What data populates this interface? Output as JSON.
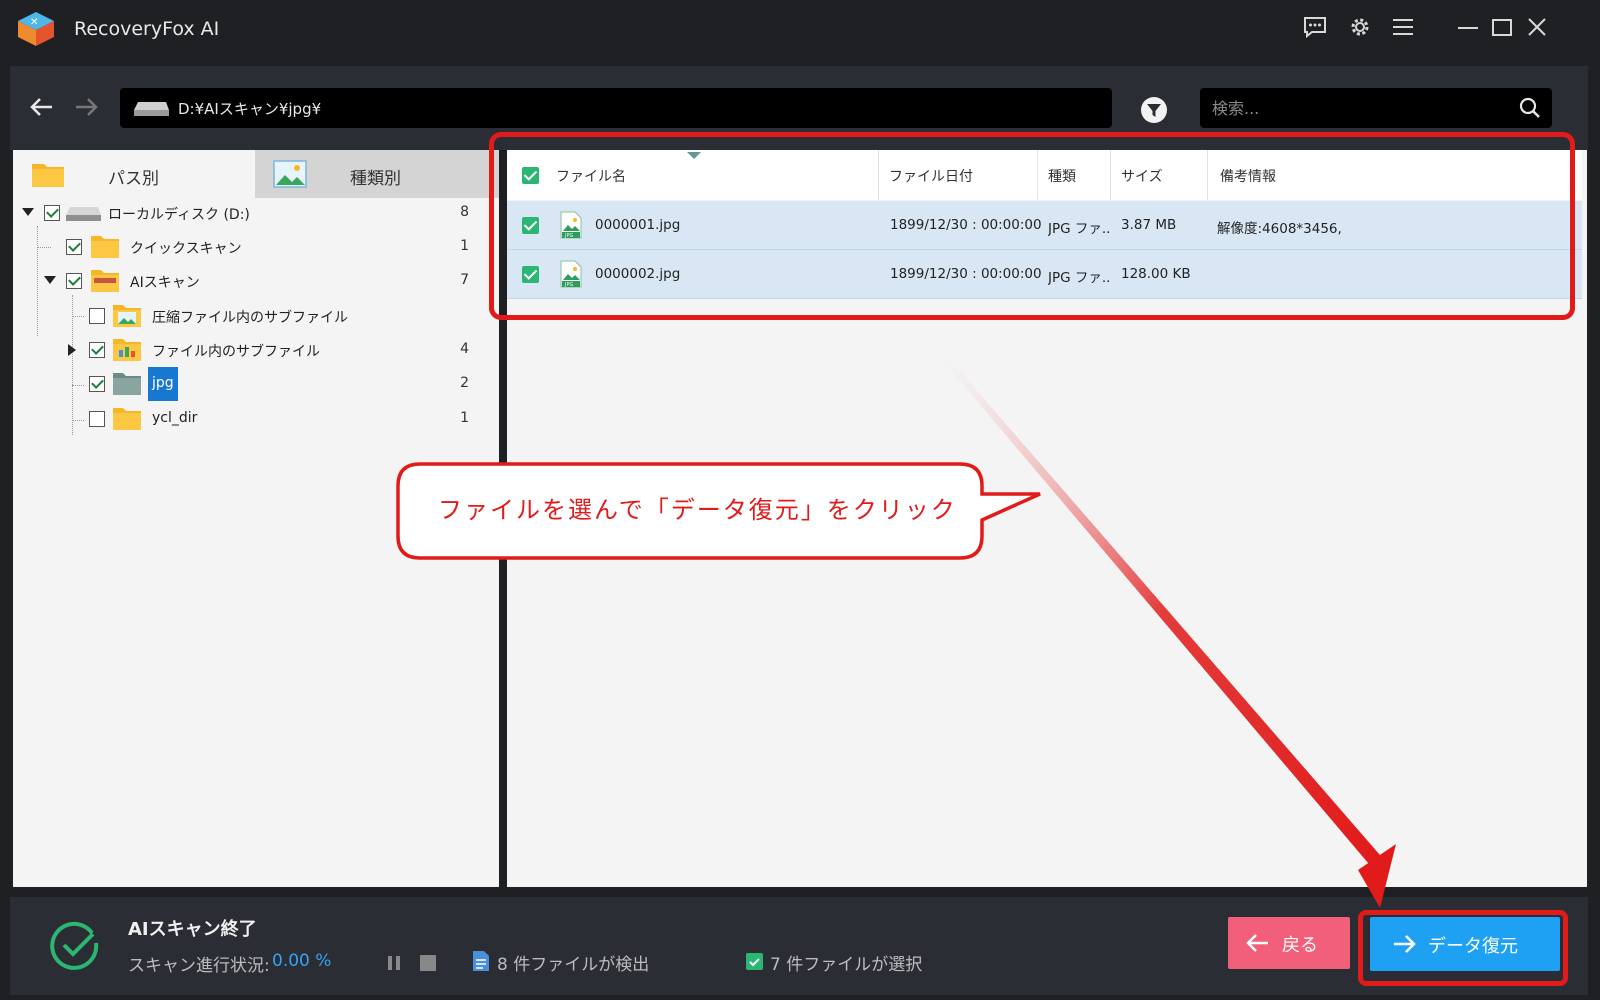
{
  "app": {
    "title": "RecoveryFox AI"
  },
  "nav": {
    "path": "D:¥AIスキャン¥jpg¥",
    "search_placeholder": "検索..."
  },
  "tabs": {
    "by_path": "パス別",
    "by_type": "種類別"
  },
  "tree": {
    "root": {
      "label": "ローカルディスク (D:)",
      "count": "8"
    },
    "quick": {
      "label": "クイックスキャン",
      "count": "1"
    },
    "ai": {
      "label": "AIスキャン",
      "count": "7"
    },
    "compressed": {
      "label": "圧縮ファイル内のサブファイル",
      "count": ""
    },
    "infile": {
      "label": "ファイル内のサブファイル",
      "count": "4"
    },
    "jpg": {
      "label": "jpg",
      "count": "2"
    },
    "ycl": {
      "label": "ycl_dir",
      "count": "1"
    }
  },
  "table": {
    "headers": {
      "name": "ファイル名",
      "date": "ファイル日付",
      "type": "種類",
      "size": "サイズ",
      "info": "備考情報"
    },
    "rows": [
      {
        "name": "0000001.jpg",
        "date": "1899/12/30 : 00:00:00",
        "type": "JPG ファ...",
        "size": "3.87 MB",
        "info": "解像度:4608*3456,"
      },
      {
        "name": "0000002.jpg",
        "date": "1899/12/30 : 00:00:00",
        "type": "JPG ファ...",
        "size": "128.00 KB",
        "info": ""
      }
    ]
  },
  "annotation": {
    "text": "ファイルを選んで「データ復元」をクリック",
    "color": "#e11a1a"
  },
  "status": {
    "title": "AIスキャン終了",
    "progress_label": "スキャン進行状況:",
    "progress_value": "0.00 %",
    "found": "8 件ファイルが検出",
    "selected": "7 件ファイルが選択"
  },
  "buttons": {
    "back": "戻る",
    "recover": "データ復元"
  },
  "colors": {
    "accent": "#1ea1f2",
    "back": "#f25f7a",
    "check": "#2bb673",
    "selection": "#1778d2"
  }
}
